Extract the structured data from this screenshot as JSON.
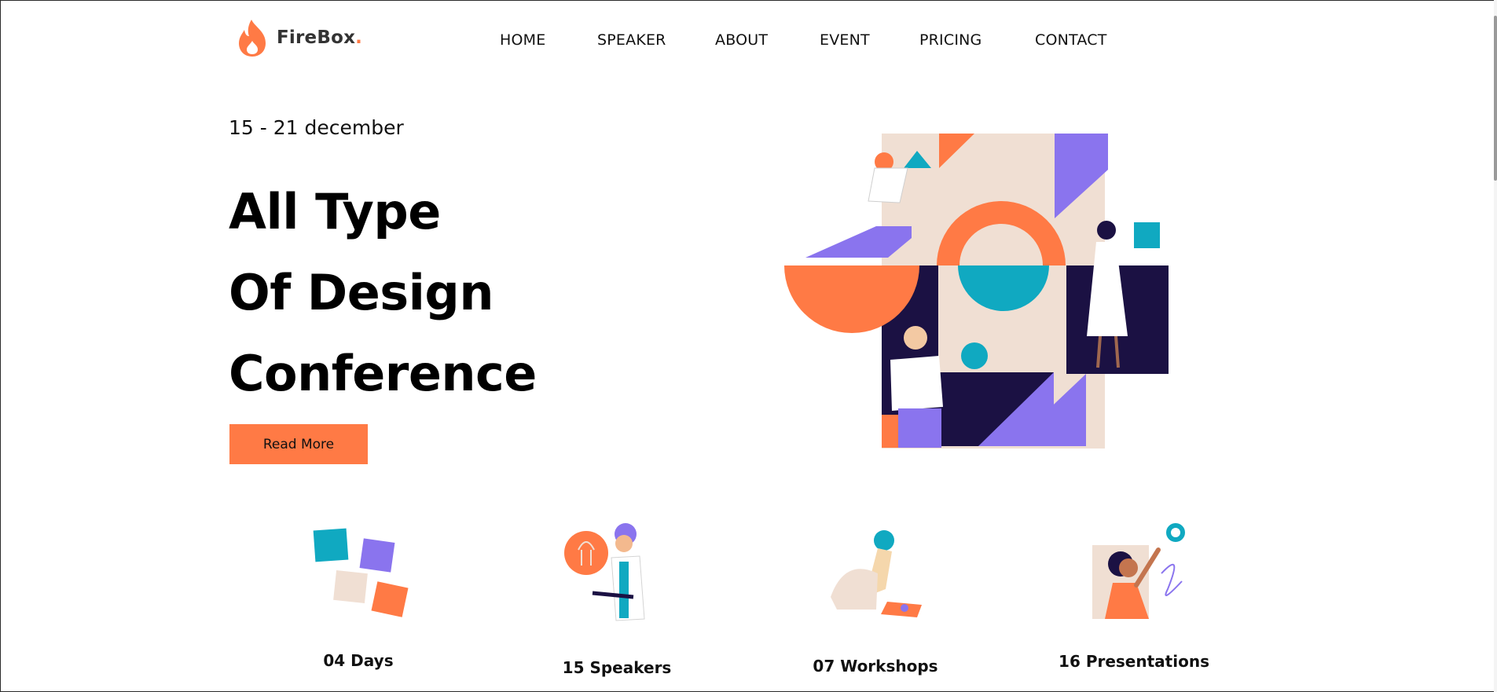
{
  "brand": {
    "name": "FireBox",
    "dot": ".",
    "accent": "#ff7a45"
  },
  "nav": {
    "items": [
      {
        "label": "HOME"
      },
      {
        "label": "SPEAKER"
      },
      {
        "label": "ABOUT"
      },
      {
        "label": "EVENT"
      },
      {
        "label": "PRICING"
      },
      {
        "label": "CONTACT"
      }
    ]
  },
  "hero": {
    "date": "15 - 21 december",
    "title_lines": [
      "All Type",
      "Of Design",
      "Conference"
    ],
    "cta_label": "Read More"
  },
  "stats": [
    {
      "label": "04 Days",
      "icon": "puzzle-icon"
    },
    {
      "label": "15 Speakers",
      "icon": "speaker-lightbulb-icon"
    },
    {
      "label": "07 Workshops",
      "icon": "workshop-person-icon"
    },
    {
      "label": "16 Presentations",
      "icon": "presentation-painter-icon"
    }
  ],
  "colors": {
    "orange": "#ff7a45",
    "teal": "#10a9c1",
    "purple": "#8a74ee",
    "navy": "#1b1143",
    "beige": "#f0dfd3"
  }
}
